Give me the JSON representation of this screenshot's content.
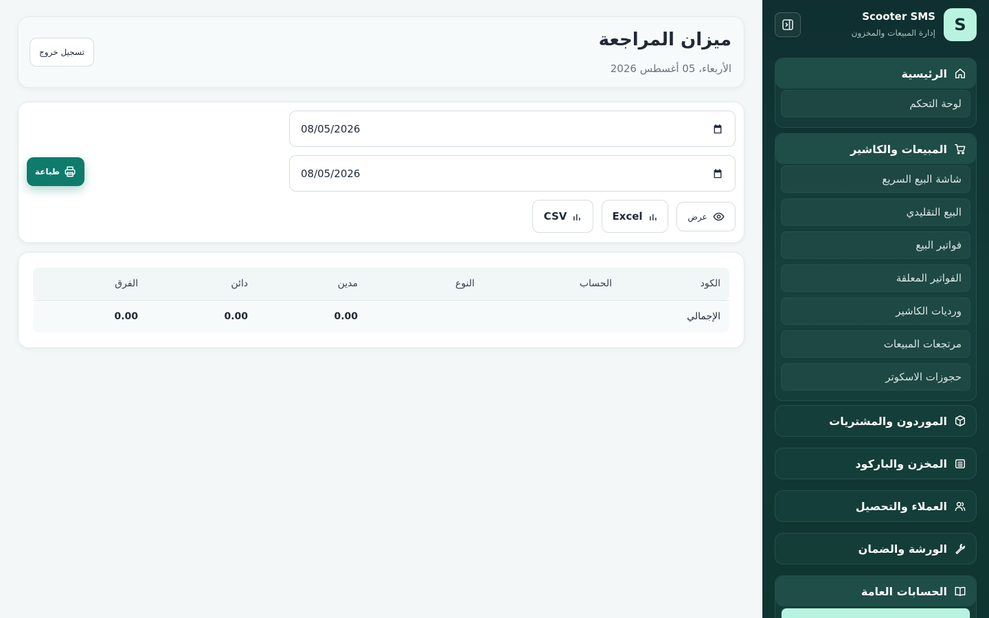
{
  "brand": {
    "logo_letter": "S",
    "name": "Scooter SMS",
    "subtitle": "إدارة المبيعات والمخزون"
  },
  "sidebar": {
    "groups": [
      {
        "label": "الرئيسية",
        "icon": "home-icon",
        "items": [
          {
            "label": "لوحة التحكم"
          }
        ]
      },
      {
        "label": "المبيعات والكاشير",
        "icon": "cart-icon",
        "items": [
          {
            "label": "شاشة البيع السريع"
          },
          {
            "label": "البيع التقليدي"
          },
          {
            "label": "فواتير البيع"
          },
          {
            "label": "الفواتير المعلقة"
          },
          {
            "label": "ورديات الكاشير"
          },
          {
            "label": "مرتجعات المبيعات"
          },
          {
            "label": "حجوزات الاسكوتر"
          }
        ]
      },
      {
        "label": "الموردون والمشتريات",
        "icon": "box-icon"
      },
      {
        "label": "المخزن والباركود",
        "icon": "warehouse-icon"
      },
      {
        "label": "العملاء والتحصيل",
        "icon": "users-icon"
      },
      {
        "label": "الورشة والضمان",
        "icon": "wrench-icon"
      },
      {
        "label": "الحسابات العامة",
        "icon": "book-icon"
      }
    ]
  },
  "header": {
    "title": "ميزان المراجعة",
    "date": "الأربعاء، 05 أغسطس 2026",
    "logout_label": "تسجيل خروج"
  },
  "filters": {
    "date_from": "08/05/2026",
    "date_to": "08/05/2026",
    "view_label": "عرض",
    "excel_label": "Excel",
    "csv_label": "CSV",
    "print_label": "طباعة"
  },
  "table": {
    "columns": [
      "الكود",
      "الحساب",
      "النوع",
      "مدين",
      "دائن",
      "الفرق"
    ],
    "total_row": {
      "label": "الإجمالي",
      "debit": "0.00",
      "credit": "0.00",
      "difference": "0.00"
    }
  },
  "colors": {
    "sidebar_bg": "#0f2f30",
    "accent": "#0f7b6c",
    "logo_bg": "#b8f3e0"
  }
}
